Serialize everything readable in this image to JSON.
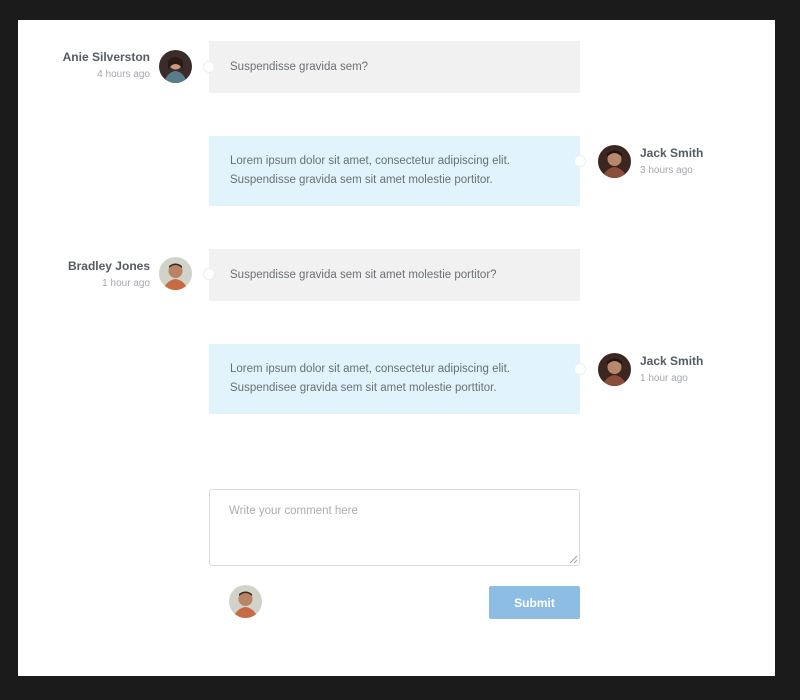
{
  "comments": [
    {
      "author": "Anie Silverston",
      "time": "4 hours ago",
      "text": "Suspendisse gravida sem?",
      "side": "left",
      "bubble_color": "#f1f1f1",
      "avatar_icon": "woman-avatar"
    },
    {
      "author": "Jack Smith",
      "time": "3 hours ago",
      "text": "Lorem ipsum dolor sit amet, consectetur adipiscing elit. Suspendisse gravida sem sit amet molestie portitor.",
      "side": "right",
      "bubble_color": "#e1f4fb",
      "avatar_icon": "man-avatar"
    },
    {
      "author": "Bradley Jones",
      "time": "1 hour ago",
      "text": "Suspendisse gravida sem sit amet molestie portitor?",
      "side": "left",
      "bubble_color": "#f1f1f1",
      "avatar_icon": "man-avatar"
    },
    {
      "author": "Jack Smith",
      "time": "1 hour ago",
      "text": "Lorem ipsum dolor sit amet, consectetur adipiscing elit. Suspendisee gravida sem sit amet molestie porttitor.",
      "side": "right",
      "bubble_color": "#e1f4fb",
      "avatar_icon": "man-avatar"
    }
  ],
  "composer": {
    "placeholder": "Write your comment here",
    "value": "",
    "submit_label": "Submit",
    "submit_color": "#8dbde2",
    "avatar_icon": "current-user-avatar"
  },
  "colors": {
    "background": "#1b1b1b",
    "panel": "#ffffff",
    "name_text": "#555b63",
    "time_text": "#a3a8ae"
  }
}
